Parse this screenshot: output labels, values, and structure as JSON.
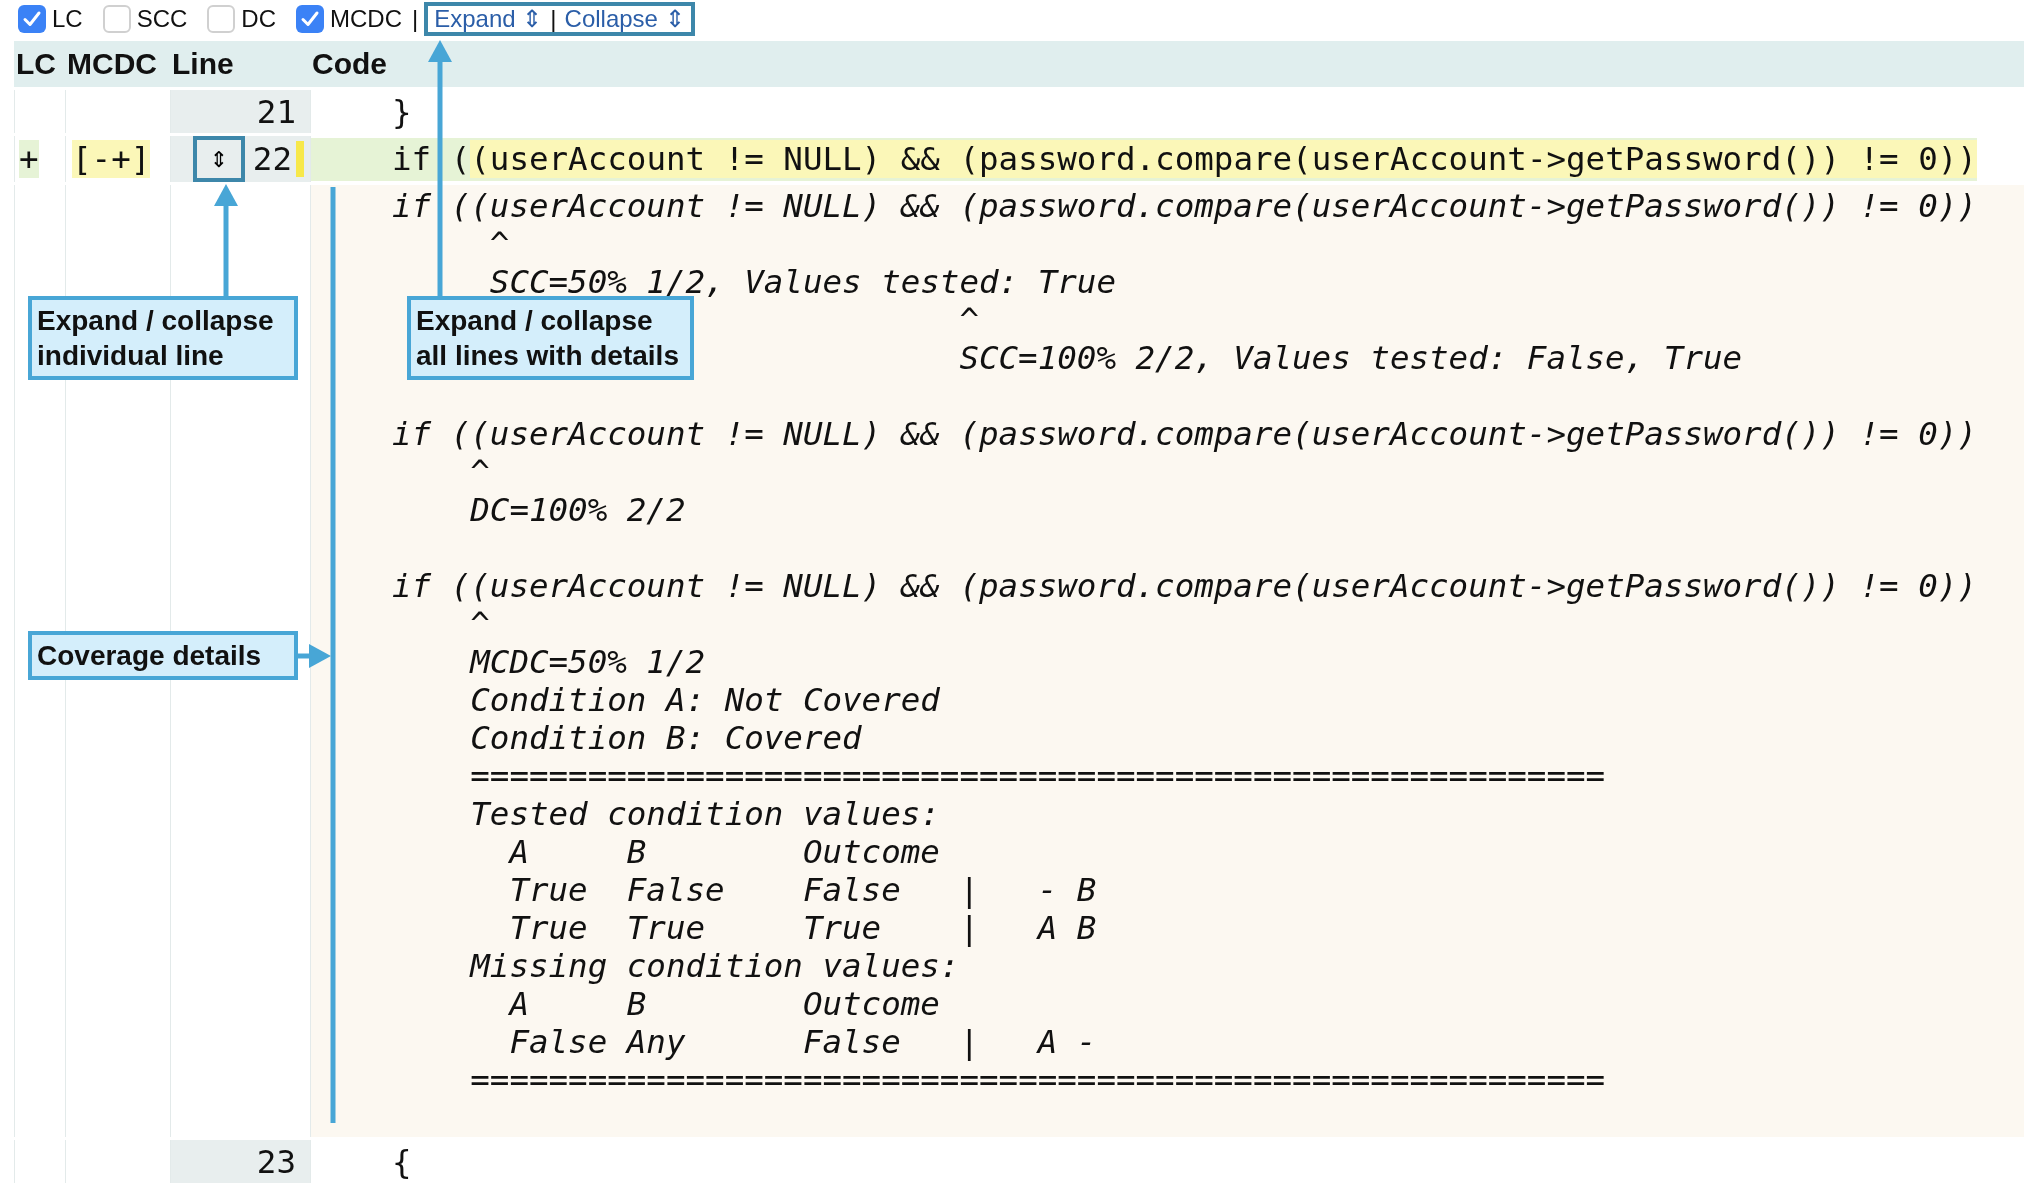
{
  "toolbar": {
    "checkboxes": [
      {
        "label": "LC",
        "checked": true
      },
      {
        "label": "SCC",
        "checked": false
      },
      {
        "label": "DC",
        "checked": false
      },
      {
        "label": "MCDC",
        "checked": true
      }
    ],
    "separators": [
      "|",
      "|"
    ],
    "links": [
      "Expand ⇕",
      "Collapse ⇕"
    ]
  },
  "table": {
    "columns": [
      "LC",
      "MCDC",
      "Line",
      "Code"
    ],
    "rows": [
      {
        "kind": "plain",
        "line": "21",
        "code": "}"
      },
      {
        "kind": "covered",
        "lc": "+",
        "mcdc": "[-+]",
        "toggle": "⇕",
        "line": "22",
        "code_prefix": "if (",
        "code_covered": "(userAccount != NULL) && (password.compare(userAccount->getPassword()) != 0))"
      },
      {
        "kind": "details",
        "blocks": [
          {
            "lines": [
              "if ((userAccount != NULL) && (password.compare(userAccount->getPassword()) != 0))",
              "     ^",
              "     SCC=50% 1/2, Values tested: True",
              "                             ^",
              "                             SCC=100% 2/2, Values tested: False, True"
            ]
          },
          {
            "lines": [
              "if ((userAccount != NULL) && (password.compare(userAccount->getPassword()) != 0))",
              "    ^",
              "    DC=100% 2/2"
            ]
          },
          {
            "lines": [
              "if ((userAccount != NULL) && (password.compare(userAccount->getPassword()) != 0))",
              "    ^",
              "    MCDC=50% 1/2",
              "    Condition A: Not Covered",
              "    Condition B: Covered",
              "    ==========================================================",
              "    Tested condition values:",
              "      A     B        Outcome",
              "      True  False    False   |   - B",
              "      True  True     True    |   A B",
              "    Missing condition values:",
              "      A     B        Outcome",
              "      False Any      False   |   A -",
              "    =========================================================="
            ]
          }
        ]
      },
      {
        "kind": "plain",
        "line": "23",
        "code": "{"
      }
    ]
  },
  "annotations": [
    {
      "kind": "line-toggle",
      "text": "Expand / collapse individual line"
    },
    {
      "kind": "all-toggle",
      "text": "Expand / collapse all lines with details"
    },
    {
      "kind": "details",
      "text": "Coverage details"
    }
  ]
}
